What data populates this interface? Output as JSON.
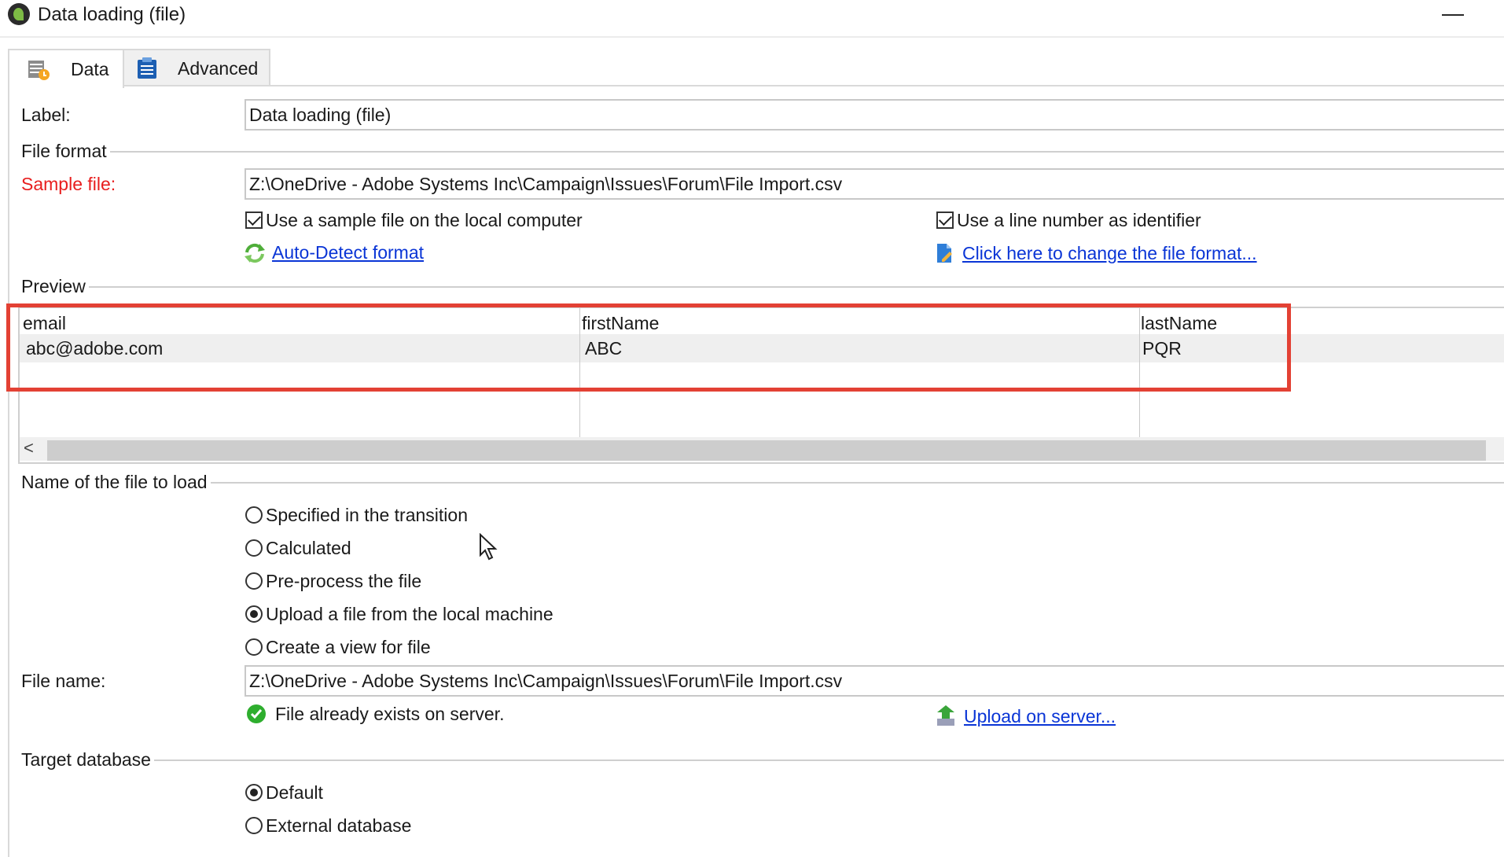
{
  "window": {
    "title": "Data loading (file)",
    "minimize": "—"
  },
  "tabs": [
    {
      "label": "Data",
      "icon": "data-table-icon",
      "active": true
    },
    {
      "label": "Advanced",
      "icon": "clipboard-icon",
      "active": false
    }
  ],
  "form": {
    "label_caption": "Label:",
    "label_value": "Data loading (file)",
    "file_format_section": "File format",
    "sample_file_caption": "Sample file:",
    "sample_file_value": "Z:\\OneDrive - Adobe Systems Inc\\Campaign\\Issues\\Forum\\File Import.csv",
    "use_sample_local": {
      "label": "Use a sample file on the local computer",
      "checked": true
    },
    "use_line_number": {
      "label": "Use a line number as identifier",
      "checked": true
    },
    "auto_detect_link": "Auto-Detect format",
    "change_format_link": "Click here to change the file format..."
  },
  "preview": {
    "section": "Preview",
    "columns": [
      "email",
      "firstName",
      "lastName"
    ],
    "rows": [
      [
        "abc@adobe.com",
        "ABC",
        "PQR"
      ]
    ],
    "scroll_left": "<"
  },
  "file_to_load": {
    "section": "Name of the file to load",
    "options": [
      {
        "label": "Specified in the transition",
        "selected": false
      },
      {
        "label": "Calculated",
        "selected": false
      },
      {
        "label": "Pre-process the file",
        "selected": false
      },
      {
        "label": "Upload a file from the local machine",
        "selected": true
      },
      {
        "label": "Create a view for file",
        "selected": false
      }
    ],
    "file_name_caption": "File name:",
    "file_name_value": "Z:\\OneDrive - Adobe Systems Inc\\Campaign\\Issues\\Forum\\File Import.csv",
    "status": "File already exists on server.",
    "upload_link": "Upload on server..."
  },
  "target_database": {
    "section": "Target database",
    "options": [
      {
        "label": "Default",
        "selected": true
      },
      {
        "label": "External database",
        "selected": false
      }
    ]
  },
  "colors": {
    "accent_link": "#0a35d6",
    "required_label": "#e81e1e",
    "highlight_box": "#e34134",
    "status_ok": "#2eae2e"
  }
}
